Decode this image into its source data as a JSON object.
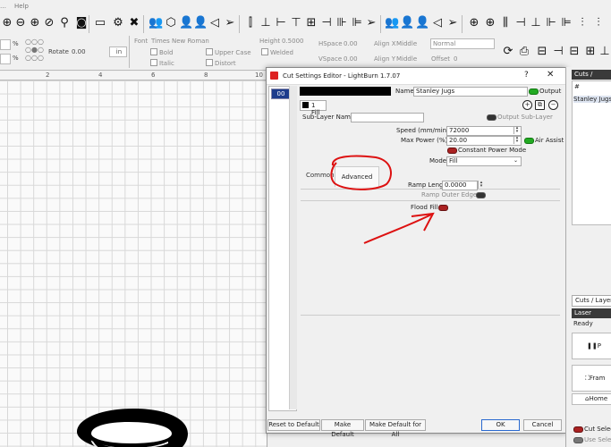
{
  "menubar": {
    "help": "Help"
  },
  "toolbar": {
    "icons": [
      "zoom-in",
      "zoom-out",
      "zoom-frame",
      "zoom-select",
      "camera",
      "monitor",
      "tools",
      "group",
      "ungroup",
      "users",
      "send",
      "align-left",
      "align-center",
      "align-right",
      "push",
      "target",
      "flip",
      "array",
      "align-h",
      "align-v",
      "distribute"
    ]
  },
  "propbar": {
    "percent_a": "%",
    "percent_b": "%",
    "rotate_label": "Rotate",
    "rotate_value": "0.00",
    "unit": "in",
    "font_label": "Font",
    "font_value": "Times New Roman",
    "height_label": "Height",
    "height_value": "0.5000",
    "hspace_label": "HSpace",
    "hspace_value": "0.00",
    "vspace_label": "VSpace",
    "vspace_value": "0.00",
    "align_x_label": "Align X",
    "align_x_value": "Middle",
    "align_y_label": "Align Y",
    "align_y_value": "Middle",
    "normal_value": "Normal",
    "offset_label": "Offset",
    "offset_value": "0",
    "bold": "Bold",
    "italic": "Italic",
    "upper_case": "Upper Case",
    "distort": "Distort",
    "welded": "Welded"
  },
  "ruler": {
    "labels": [
      "2",
      "4",
      "6",
      "8",
      "10"
    ]
  },
  "dialog": {
    "title": "Cut Settings Editor - LightBurn 1.7.07",
    "help": "?",
    "close": "✕",
    "layer_number": "00",
    "name_label": "Name",
    "name_value": "Stanley Jugs",
    "output_label": "Output",
    "sublayer_tab": "1 Fill",
    "sublayer_name_label": "Sub-Layer Name",
    "sublayer_name_value": "",
    "output_sublayer_label": "Output Sub-Layer",
    "speed_label": "Speed (mm/min)",
    "speed_value": "72000",
    "max_power_label": "Max Power (%)",
    "max_power_value": "20.00",
    "air_assist_label": "Air Assist",
    "constant_power_label": "Constant Power Mode",
    "mode_label": "Mode",
    "mode_value": "Fill",
    "tab_common": "Common",
    "tab_advanced": "Advanced",
    "ramp_length_label": "Ramp Length",
    "ramp_length_value": "0.0000",
    "ramp_outer_edge_label": "Ramp Outer Edge",
    "flood_fill_label": "Flood Fill",
    "reset_default": "Reset to Default",
    "make_default": "Make Default",
    "make_default_all": "Make Default for All",
    "ok": "OK",
    "cancel": "Cancel",
    "colors": {
      "layer_selected": "#1e3c8c",
      "toggle_on": "#22aa22",
      "toggle_off": "#aa2222",
      "annotation": "#dd1111"
    }
  },
  "rightpanel": {
    "tab1": "Cuts / Layers",
    "hash": "#",
    "row1": "Stanley Jugs",
    "tab2": "Cuts / Layers",
    "laser_header": "Laser",
    "ready": "Ready",
    "pause_label": "P",
    "frame_label": "Fram",
    "home_label": "Home",
    "cut_selected": "Cut Selec",
    "use_selection": "Use Sele"
  }
}
